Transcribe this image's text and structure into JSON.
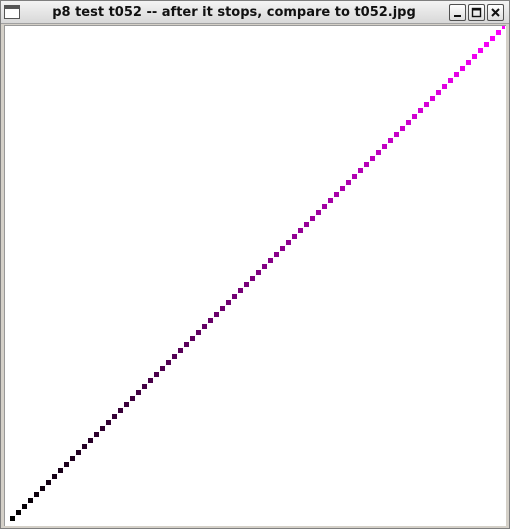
{
  "window": {
    "title": "p8 test t052 -- after it stops, compare to t052.jpg"
  },
  "titlebar_buttons": {
    "minimize_icon": "minimize-icon",
    "maximize_icon": "maximize-icon",
    "close_icon": "close-icon"
  },
  "sketch": {
    "background": "#ffffff",
    "dot_count": 83,
    "start_color": "#000000",
    "end_color": "#ff00ff"
  }
}
